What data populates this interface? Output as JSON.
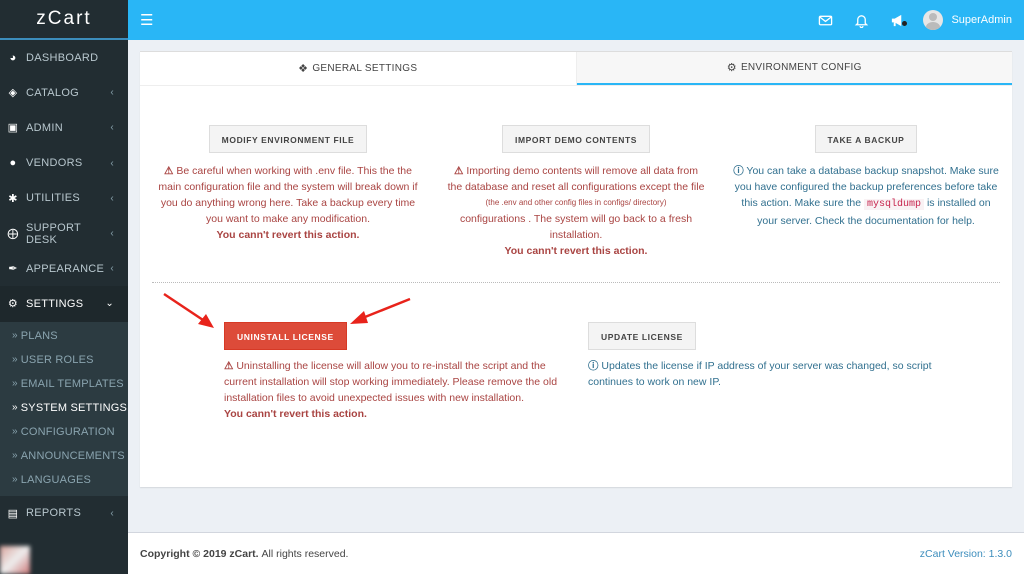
{
  "brand": "zCart",
  "header": {
    "user_name": "SuperAdmin",
    "icons": [
      "menu-icon",
      "mail-icon",
      "bell-icon",
      "megaphone-icon",
      "avatar"
    ]
  },
  "sidebar": {
    "items": [
      {
        "label": "DASHBOARD",
        "icon": "dashboard-icon"
      },
      {
        "label": "CATALOG",
        "icon": "tag-icon"
      },
      {
        "label": "ADMIN",
        "icon": "lock-icon"
      },
      {
        "label": "VENDORS",
        "icon": "map-marker-icon"
      },
      {
        "label": "UTILITIES",
        "icon": "asterisk-icon"
      },
      {
        "label": "SUPPORT DESK",
        "icon": "lifebuoy-icon"
      },
      {
        "label": "APPEARANCE",
        "icon": "brush-icon"
      },
      {
        "label": "SETTINGS",
        "icon": "gears-icon"
      }
    ],
    "settings_sub": [
      {
        "label": "PLANS"
      },
      {
        "label": "USER ROLES"
      },
      {
        "label": "EMAIL TEMPLATES"
      },
      {
        "label": "SYSTEM SETTINGS"
      },
      {
        "label": "CONFIGURATION"
      },
      {
        "label": "ANNOUNCEMENTS"
      },
      {
        "label": "LANGUAGES"
      }
    ],
    "reports": {
      "label": "REPORTS",
      "icon": "map-icon"
    }
  },
  "tabs": {
    "general": "GENERAL SETTINGS",
    "env": "ENVIRONMENT CONFIG"
  },
  "modify_env": {
    "button": "MODIFY ENVIRONMENT FILE",
    "line1": "Be careful when working with .env file. This the the",
    "line2": "main configuration file and the system will break down if",
    "line3": "you do anything wrong here. Take a backup every time",
    "line4": "you want to make any modification.",
    "revert": "You cann't revert this action."
  },
  "import_demo": {
    "button": "IMPORT DEMO CONTENTS",
    "line1": "Importing demo contents will remove all data from",
    "line2": "the database and reset all configurations except the file",
    "line3": "(the .env and other config files in configs/ directory)",
    "line4": "configurations . The system will go back to a fresh",
    "line5": "installation.",
    "revert": "You cann't revert this action."
  },
  "backup": {
    "button": "TAKE A BACKUP",
    "line1": "You can take a database backup snapshot. Make sure",
    "line2": "you have configured the backup preferences before take",
    "line3_pre": "this action. Make sure the",
    "line3_code": "mysqldump",
    "line3_post": "is installed on",
    "line4": "your server. Check the documentation for help."
  },
  "uninstall": {
    "button": "UNINSTALL LICENSE",
    "line1": "Uninstalling the license will allow you to re-install the script and the",
    "line2": "current installation will stop working immediately. Please remove the old",
    "line3": "installation files to avoid unexpected issues with new installation.",
    "revert": "You cann't revert this action."
  },
  "update": {
    "button": "UPDATE LICENSE",
    "line1": "Updates the license if IP address of your server was changed, so script",
    "line2": "continues to work on new IP."
  },
  "footer": {
    "copyright": "Copyright © 2019 zCart.",
    "rights": "All rights reserved.",
    "version": "zCart Version: 1.3.0"
  },
  "colors": {
    "topbar": "#29b6f6",
    "sidebar": "#222d32",
    "danger": "#dd4b39",
    "warn_text": "#a94442",
    "info_text": "#31708f"
  }
}
